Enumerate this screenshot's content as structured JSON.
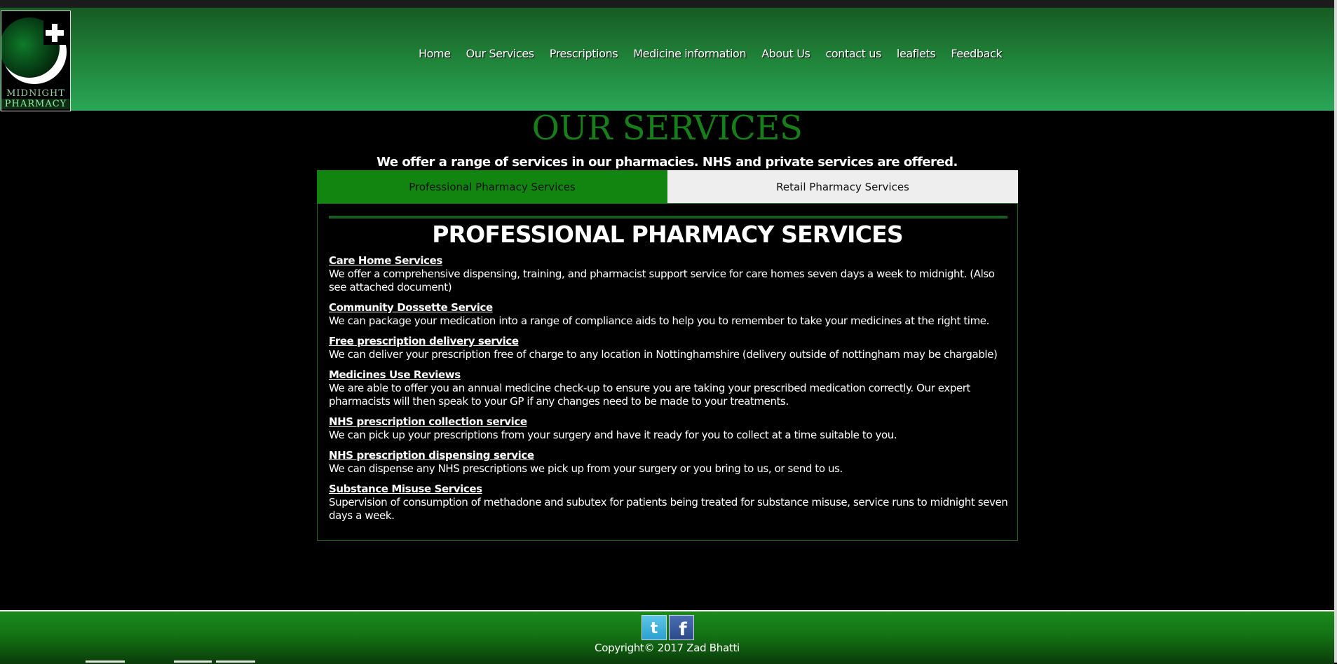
{
  "brand": {
    "line1": "MIDNIGHT",
    "line2": "PHARMACY",
    "colors": {
      "header_dark": "#175b24",
      "header_light": "#2aa657",
      "accent": "#177f1a"
    }
  },
  "nav": {
    "items": [
      "Home",
      "Our Services",
      "Prescriptions",
      "Medicine information",
      "About Us",
      "contact us",
      "leaflets",
      "Feedback"
    ]
  },
  "page": {
    "title": "OUR SERVICES",
    "subtitle": "We offer a range of services in our pharmacies. NHS and private services are offered."
  },
  "tabs": {
    "professional": "Professional Pharmacy Services",
    "retail": "Retail Pharmacy Services",
    "active": "professional"
  },
  "panel": {
    "title": "PROFESSIONAL PHARMACY SERVICES",
    "services": [
      {
        "name": " Care Home Services",
        "desc": " We offer a comprehensive dispensing, training, and pharmacist support service for care homes seven days a week to midnight. (Also see attached document)"
      },
      {
        "name": " Community Dossette Service",
        "desc": "We can package your medication into a range of compliance aids to help you to remember to take your medicines at the right time."
      },
      {
        "name": "Free prescription delivery service",
        "desc": " We can deliver your prescription free of charge to any location in Nottinghamshire (delivery outside of nottingham may be chargable)"
      },
      {
        "name": "Medicines Use Reviews",
        "desc": " We are able to offer you an annual medicine check-up to ensure you are taking your prescribed medication correctly. Our expert pharmacists will then speak to your GP if any changes need to be made to your treatments."
      },
      {
        "name": "NHS prescription collection service",
        "desc": "We can pick up your prescriptions from your surgery and have it ready for you to collect at a time suitable to you."
      },
      {
        "name": "NHS prescription dispensing service",
        "desc": "We can dispense any NHS prescriptions we pick up from your surgery or you bring to us, or send to us."
      },
      {
        "name": "Substance Misuse Services",
        "desc": "Supervision of consumption of methadone and subutex for patients being treated for substance misuse, service runs to midnight seven days a week."
      }
    ]
  },
  "footer": {
    "social": [
      "twitter-icon",
      "facebook-icon"
    ],
    "copyright": "Copyright© 2017 Zad Bhatti"
  }
}
